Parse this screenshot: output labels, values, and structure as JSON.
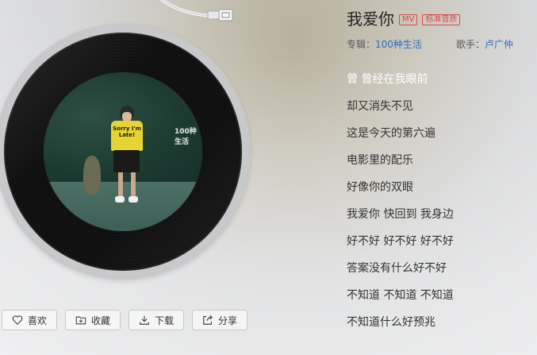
{
  "song": {
    "title": "我爱你",
    "tags": [
      "MV",
      "标准音质"
    ],
    "album_label": "专辑：",
    "album": "100种生活",
    "artist_label": "歌手：",
    "artist": "卢广仲"
  },
  "cover": {
    "badge": "100种生活",
    "shirt_text": "Sorry I'm Late!"
  },
  "actions": [
    {
      "label": "喜欢",
      "icon": "heart-icon"
    },
    {
      "label": "收藏",
      "icon": "add-folder-icon"
    },
    {
      "label": "下载",
      "icon": "download-icon"
    },
    {
      "label": "分享",
      "icon": "share-icon"
    }
  ],
  "lyrics": [
    "曾 曾经在我眼前",
    "却又消失不见",
    "这是今天的第六遍",
    "电影里的配乐",
    "好像你的双眼",
    "我爱你 快回到 我身边",
    "好不好 好不好 好不好",
    "答案没有什么好不好",
    "不知道 不知道 不知道",
    "不知道什么好预兆"
  ],
  "current_lyric_index": 0,
  "colors": {
    "accent_link": "#2f6ec2",
    "tag_red": "#d84a4a"
  }
}
